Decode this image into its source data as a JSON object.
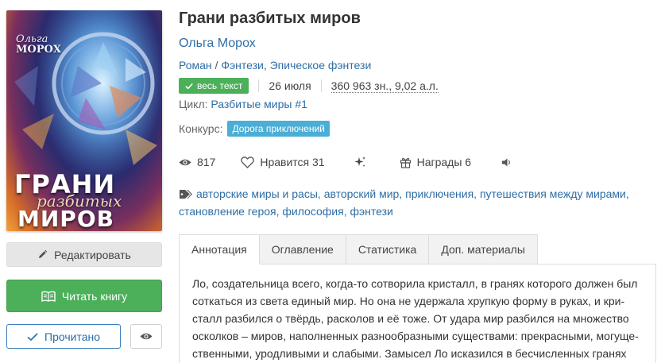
{
  "cover": {
    "author_first": "Ольга",
    "author_last": "МОРОХ",
    "title_line1": "ГРАНИ",
    "title_line2": "разбитых",
    "title_line3": "МИРОВ"
  },
  "sidebar": {
    "edit_label": "Редактировать",
    "read_label": "Читать книгу",
    "done_label": "Прочитано"
  },
  "book": {
    "title": "Грани разбитых миров",
    "author": "Ольга Морох",
    "genres": [
      "Роман",
      "Фэнтези",
      "Эпическое фэнтези"
    ],
    "genre_sep1": " / ",
    "genre_sep2": ", ",
    "full_text_badge": "весь текст",
    "date": "26 июля",
    "size": "360 963 зн., 9,02 а.л.",
    "cycle_label": "Цикл: ",
    "cycle_value": "Разбитые миры #1",
    "contest_label": "Конкурс:",
    "contest_value": "Дорога приключений"
  },
  "stats": {
    "views": "817",
    "likes_label": "Нравится 31",
    "awards_label": "Награды 6"
  },
  "tags": [
    "авторские миры и расы",
    "авторский мир",
    "приключения",
    "путешествия между мирами",
    "становление героя",
    "философия",
    "фэнтези"
  ],
  "tabs": [
    "Аннотация",
    "Оглавление",
    "Статистика",
    "Доп. материалы"
  ],
  "annotation_lines": [
    "Ло, создательница всего, когда-то сотворила кристалл, в гранях которого должен был",
    "соткаться из света единый мир. Но она не удержала хрупкую форму в руках, и кри-",
    "сталл разбился о твёрдь, расколов и её тоже. От удара мир разбился на множество",
    "осколков – миров, наполненных разнообразными существами: прекрасными, могуще-",
    "ственными, уродливыми и слабыми. Замысел Ло исказился в бесчисленных гранях"
  ],
  "colors": {
    "link": "#2e6ea6",
    "green": "#4cb05a",
    "contest": "#4aaed6"
  }
}
